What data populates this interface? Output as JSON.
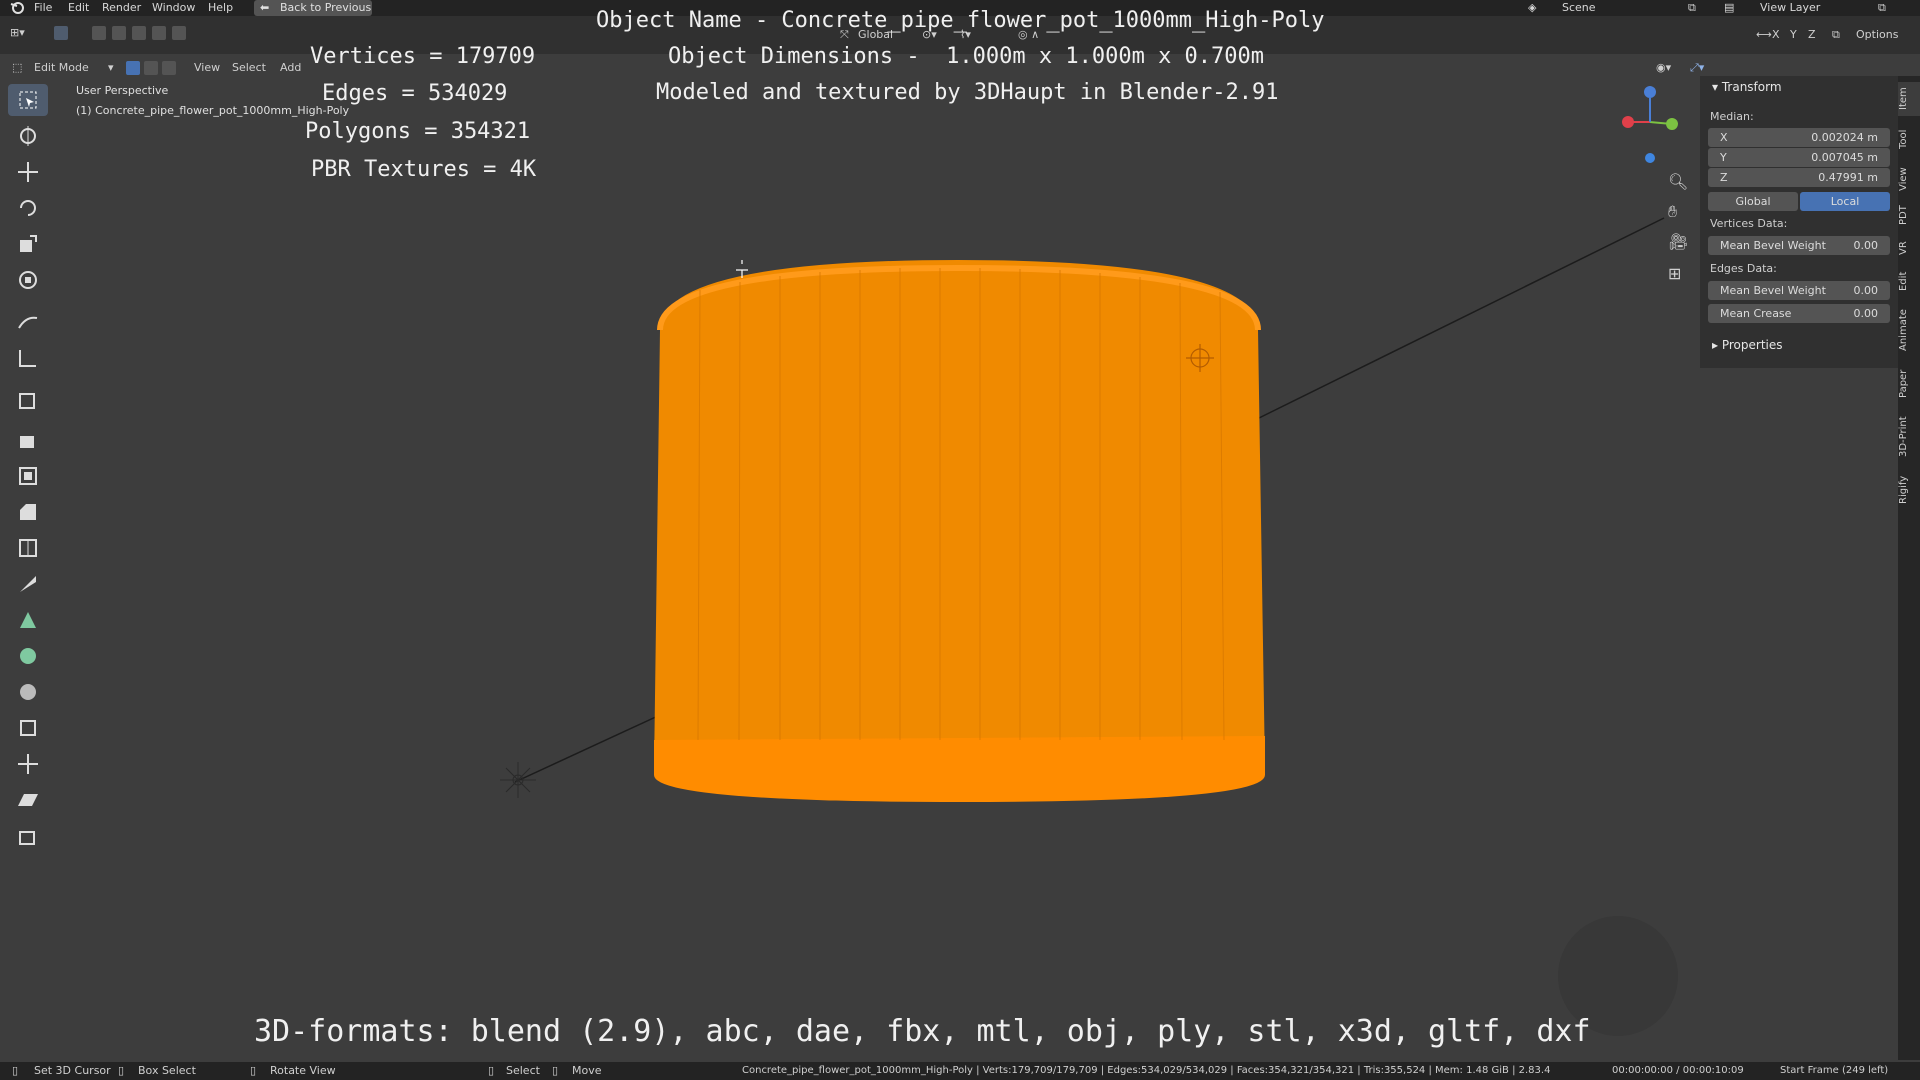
{
  "menu": {
    "items": [
      "File",
      "Edit",
      "Render",
      "Window",
      "Help"
    ],
    "back_label": "Back to Previous",
    "scene": "Scene",
    "view_layer": "View Layer"
  },
  "header": {
    "mode": "Edit Mode",
    "view": "View",
    "select": "Select",
    "add": "Add",
    "orientation": "Global",
    "options": "Options",
    "axes": [
      "X",
      "Y",
      "Z"
    ]
  },
  "viewport": {
    "perspective": "User Perspective",
    "object_label": "(1) Concrete_pipe_flower_pot_1000mm_High-Poly"
  },
  "overlay": {
    "stats": [
      "Vertices = 179709",
      "Edges = 534029",
      "Polygons = 354321",
      "PBR Textures = 4K"
    ],
    "info": [
      "Object Name - Concrete_pipe_flower_pot_1000mm_High-Poly",
      "Object Dimensions -  1.000m x 1.000m x 0.700m",
      "Modeled and textured by 3DHaupt in Blender-2.91"
    ],
    "formats": "3D-formats: blend (2.9), abc, dae, fbx, mtl, obj, ply, stl, x3d, gltf, dxf"
  },
  "npanel": {
    "transform": "Transform",
    "median": "Median:",
    "x_label": "X",
    "x_value": "0.002024 m",
    "y_label": "Y",
    "y_value": "0.007045 m",
    "z_label": "Z",
    "z_value": "0.47991 m",
    "global": "Global",
    "local": "Local",
    "vertices_data": "Vertices Data:",
    "vert_bevel_label": "Mean Bevel Weight",
    "vert_bevel_value": "0.00",
    "edges_data": "Edges Data:",
    "edge_bevel_label": "Mean Bevel Weight",
    "edge_bevel_value": "0.00",
    "crease_label": "Mean Crease",
    "crease_value": "0.00",
    "properties": "Properties",
    "tabs": [
      "Item",
      "Tool",
      "View",
      "PDT",
      "VR",
      "Edit",
      "Animate",
      "Paper",
      "3D-Print",
      "Rigify"
    ]
  },
  "status": {
    "set_cursor": "Set 3D Cursor",
    "box_select": "Box Select",
    "rotate_view": "Rotate View",
    "select": "Select",
    "move": "Move",
    "stats": "Concrete_pipe_flower_pot_1000mm_High-Poly | Verts:179,709/179,709 | Edges:534,029/534,029 | Faces:354,321/354,321 | Tris:355,524 | Mem: 1.48 GiB | 2.83.4",
    "time": "00:00:00:00 / 00:00:10:09",
    "frame": "Start Frame (249 left)"
  },
  "colors": {
    "object_orange": "#f08a00",
    "active_blue": "#4772b3",
    "panel_bg": "#303030"
  }
}
